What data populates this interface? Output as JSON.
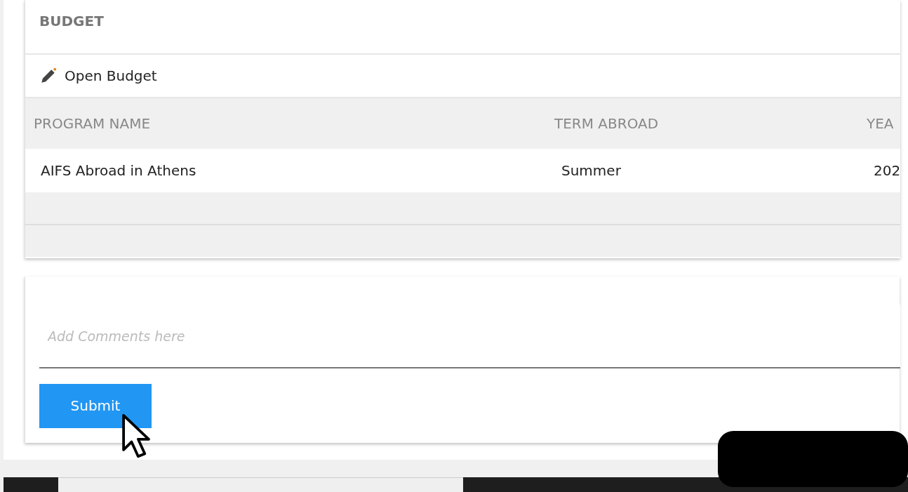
{
  "budget_card": {
    "title": "BUDGET",
    "action": {
      "label": "Open Budget"
    },
    "table": {
      "columns": [
        "PROGRAM NAME",
        "TERM ABROAD",
        "YEA"
      ],
      "rows": [
        {
          "kind": "data",
          "cells": [
            "AIFS Abroad in Athens",
            "Summer",
            "202"
          ]
        },
        {
          "kind": "blank"
        },
        {
          "kind": "blank"
        }
      ]
    }
  },
  "comment_card": {
    "placeholder": "Add Comments here",
    "button": "Submit"
  }
}
